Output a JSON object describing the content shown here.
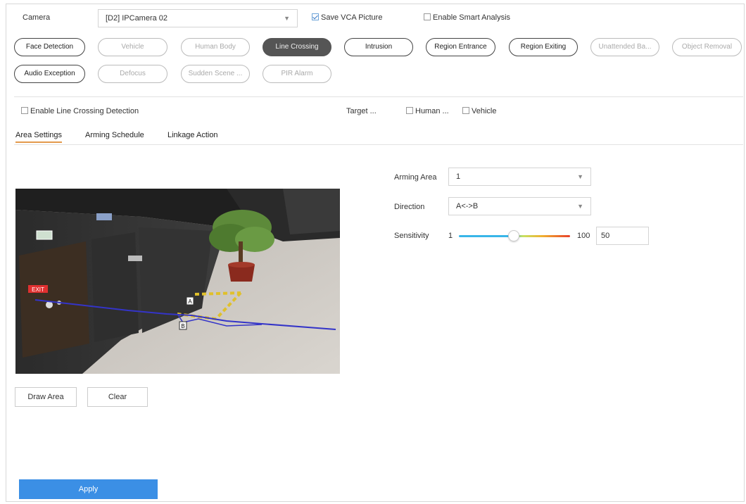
{
  "camera": {
    "label": "Camera",
    "selected": "[D2] IPCamera 02",
    "save_vca_label": "Save VCA Picture",
    "save_vca_checked": true,
    "smart_analysis_label": "Enable Smart Analysis",
    "smart_analysis_checked": false
  },
  "detection_tabs": [
    {
      "label": "Face Detection",
      "state": "enabled"
    },
    {
      "label": "Vehicle",
      "state": "disabled"
    },
    {
      "label": "Human Body",
      "state": "disabled"
    },
    {
      "label": "Line Crossing",
      "state": "active"
    },
    {
      "label": "Intrusion",
      "state": "enabled"
    },
    {
      "label": "Region Entrance",
      "state": "enabled"
    },
    {
      "label": "Region Exiting",
      "state": "enabled"
    },
    {
      "label": "Unattended Ba...",
      "state": "disabled"
    },
    {
      "label": "Object Removal",
      "state": "disabled"
    },
    {
      "label": "Audio Exception",
      "state": "enabled"
    },
    {
      "label": "Defocus",
      "state": "disabled"
    },
    {
      "label": "Sudden Scene ...",
      "state": "disabled"
    },
    {
      "label": "PIR Alarm",
      "state": "disabled"
    }
  ],
  "enable": {
    "label": "Enable Line Crossing Detection",
    "checked": false
  },
  "target": {
    "label": "Target ...",
    "human_label": "Human ...",
    "vehicle_label": "Vehicle"
  },
  "sub_tabs": [
    {
      "label": "Area Settings",
      "active": true
    },
    {
      "label": "Arming Schedule",
      "active": false
    },
    {
      "label": "Linkage Action",
      "active": false
    }
  ],
  "settings": {
    "arming_area_label": "Arming Area",
    "arming_area_value": "1",
    "direction_label": "Direction",
    "direction_value": "A<->B",
    "sensitivity_label": "Sensitivity",
    "sensitivity_min": "1",
    "sensitivity_max": "100",
    "sensitivity_value": "50"
  },
  "buttons": {
    "draw_area": "Draw Area",
    "clear": "Clear",
    "apply": "Apply"
  },
  "video": {
    "exit_sign": "EXIT",
    "point_a": "A",
    "point_b": "B"
  },
  "colors": {
    "accent": "#3b8fe5",
    "tab_underline": "#e39a4c",
    "active_pill": "#555555",
    "line": "#3434c8"
  }
}
